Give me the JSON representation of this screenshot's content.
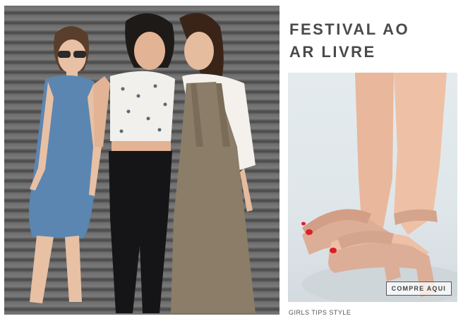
{
  "headline": {
    "line1": "FESTIVAL AO",
    "line2": "AR LIVRE"
  },
  "cta_label": "COMPRE AQUI",
  "caption": "GIRLS TIPS STYLE",
  "colors": {
    "headline_text": "#4a4a4a",
    "sandal": "#dcae98",
    "nail_polish": "#d91f2a",
    "background_wall": "#6e6e6e",
    "right_bg": "#e4ebee"
  },
  "images": {
    "left_photo": "three-women-outdoor-photo",
    "right_photo": "nude-strappy-sandals-photo"
  }
}
